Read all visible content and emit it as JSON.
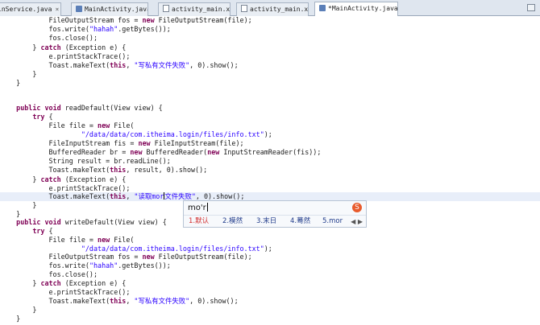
{
  "tabs": [
    {
      "label": "inService.java",
      "type": "java",
      "active": false
    },
    {
      "label": "MainActivity.java",
      "type": "java",
      "active": false
    },
    {
      "label": "activity_main.xml",
      "type": "xml",
      "active": false
    },
    {
      "label": "activity_main.xml",
      "type": "xml",
      "active": false
    },
    {
      "label": "*MainActivity.java",
      "type": "java",
      "active": true
    }
  ],
  "code_lines": [
    {
      "indent": "            ",
      "segs": [
        {
          "t": "FileOutputStream fos = "
        },
        {
          "t": "new",
          "c": "kw"
        },
        {
          "t": " FileOutputStream(file);"
        }
      ]
    },
    {
      "indent": "            ",
      "segs": [
        {
          "t": "fos.write("
        },
        {
          "t": "\"hahah\"",
          "c": "str"
        },
        {
          "t": ".getBytes());"
        }
      ]
    },
    {
      "indent": "            ",
      "segs": [
        {
          "t": "fos.close();"
        }
      ]
    },
    {
      "indent": "        ",
      "segs": [
        {
          "t": "} "
        },
        {
          "t": "catch",
          "c": "kw"
        },
        {
          "t": " (Exception e) {"
        }
      ]
    },
    {
      "indent": "            ",
      "segs": [
        {
          "t": "e.printStackTrace();"
        }
      ]
    },
    {
      "indent": "            ",
      "segs": [
        {
          "t": "Toast.makeText("
        },
        {
          "t": "this",
          "c": "kw"
        },
        {
          "t": ", "
        },
        {
          "t": "\"写私有文件失败\"",
          "c": "str"
        },
        {
          "t": ", 0).show();"
        }
      ]
    },
    {
      "indent": "        ",
      "segs": [
        {
          "t": "}"
        }
      ]
    },
    {
      "indent": "    ",
      "segs": [
        {
          "t": "}"
        }
      ]
    },
    {
      "indent": "",
      "segs": []
    },
    {
      "indent": "",
      "segs": []
    },
    {
      "indent": "    ",
      "segs": [
        {
          "t": "public",
          "c": "kw"
        },
        {
          "t": " "
        },
        {
          "t": "void",
          "c": "kw"
        },
        {
          "t": " readDefault(View view) {"
        }
      ]
    },
    {
      "indent": "        ",
      "segs": [
        {
          "t": "try",
          "c": "kw"
        },
        {
          "t": " {"
        }
      ]
    },
    {
      "indent": "            ",
      "segs": [
        {
          "t": "File file = "
        },
        {
          "t": "new",
          "c": "kw"
        },
        {
          "t": " File("
        }
      ]
    },
    {
      "indent": "                    ",
      "segs": [
        {
          "t": "\"/data/data/com.itheima.login/files/info.txt\"",
          "c": "str"
        },
        {
          "t": ");"
        }
      ]
    },
    {
      "indent": "            ",
      "segs": [
        {
          "t": "FileInputStream fis = "
        },
        {
          "t": "new",
          "c": "kw"
        },
        {
          "t": " FileInputStream(file);"
        }
      ]
    },
    {
      "indent": "            ",
      "segs": [
        {
          "t": "BufferedReader br = "
        },
        {
          "t": "new",
          "c": "kw"
        },
        {
          "t": " BufferedReader("
        },
        {
          "t": "new",
          "c": "kw"
        },
        {
          "t": " InputStreamReader(fis));"
        }
      ]
    },
    {
      "indent": "            ",
      "segs": [
        {
          "t": "String result = br.readLine();"
        }
      ]
    },
    {
      "indent": "            ",
      "segs": [
        {
          "t": "Toast.makeText("
        },
        {
          "t": "this",
          "c": "kw"
        },
        {
          "t": ", result, 0).show();"
        }
      ]
    },
    {
      "indent": "        ",
      "segs": [
        {
          "t": "} "
        },
        {
          "t": "catch",
          "c": "kw"
        },
        {
          "t": " (Exception e) {"
        }
      ]
    },
    {
      "indent": "            ",
      "segs": [
        {
          "t": "e.printStackTrace();"
        }
      ]
    },
    {
      "indent": "            ",
      "segs": [
        {
          "t": "Toast.makeText("
        },
        {
          "t": "this",
          "c": "kw"
        },
        {
          "t": ", "
        },
        {
          "t": "\"读取mor",
          "c": "str"
        },
        {
          "t": "",
          "c": "cur"
        },
        {
          "t": "文件失败\"",
          "c": "str"
        },
        {
          "t": ", 0).show();"
        }
      ],
      "highlight": true
    },
    {
      "indent": "        ",
      "segs": [
        {
          "t": "}"
        }
      ]
    },
    {
      "indent": "    ",
      "segs": [
        {
          "t": "}"
        }
      ]
    },
    {
      "indent": "    ",
      "segs": [
        {
          "t": "public",
          "c": "kw"
        },
        {
          "t": " "
        },
        {
          "t": "void",
          "c": "kw"
        },
        {
          "t": " writeDefault(View view) {"
        }
      ]
    },
    {
      "indent": "        ",
      "segs": [
        {
          "t": "try",
          "c": "kw"
        },
        {
          "t": " {"
        }
      ]
    },
    {
      "indent": "            ",
      "segs": [
        {
          "t": "File file = "
        },
        {
          "t": "new",
          "c": "kw"
        },
        {
          "t": " File("
        }
      ]
    },
    {
      "indent": "                    ",
      "segs": [
        {
          "t": "\"/data/data/com.itheima.login/files/info.txt\"",
          "c": "str"
        },
        {
          "t": ");"
        }
      ]
    },
    {
      "indent": "            ",
      "segs": [
        {
          "t": "FileOutputStream fos = "
        },
        {
          "t": "new",
          "c": "kw"
        },
        {
          "t": " FileOutputStream(file);"
        }
      ]
    },
    {
      "indent": "            ",
      "segs": [
        {
          "t": "fos.write("
        },
        {
          "t": "\"hahah\"",
          "c": "str"
        },
        {
          "t": ".getBytes());"
        }
      ]
    },
    {
      "indent": "            ",
      "segs": [
        {
          "t": "fos.close();"
        }
      ]
    },
    {
      "indent": "        ",
      "segs": [
        {
          "t": "} "
        },
        {
          "t": "catch",
          "c": "kw"
        },
        {
          "t": " (Exception e) {"
        }
      ]
    },
    {
      "indent": "            ",
      "segs": [
        {
          "t": "e.printStackTrace();"
        }
      ]
    },
    {
      "indent": "            ",
      "segs": [
        {
          "t": "Toast.makeText("
        },
        {
          "t": "this",
          "c": "kw"
        },
        {
          "t": ", "
        },
        {
          "t": "\"写私有文件失败\"",
          "c": "str"
        },
        {
          "t": ", 0).show();"
        }
      ]
    },
    {
      "indent": "        ",
      "segs": [
        {
          "t": "}"
        }
      ]
    },
    {
      "indent": "    ",
      "segs": [
        {
          "t": "}"
        }
      ]
    }
  ],
  "ime": {
    "composition": "mo'r",
    "logo_glyph": "S",
    "candidates": [
      "1.默认",
      "2.模然",
      "3.末日",
      "4.蓦然",
      "5.mor"
    ],
    "nav": "◀ ▶"
  },
  "colors": {
    "keyword": "#7f0055",
    "string": "#2a00ff",
    "current_line": "#e8eef9"
  }
}
